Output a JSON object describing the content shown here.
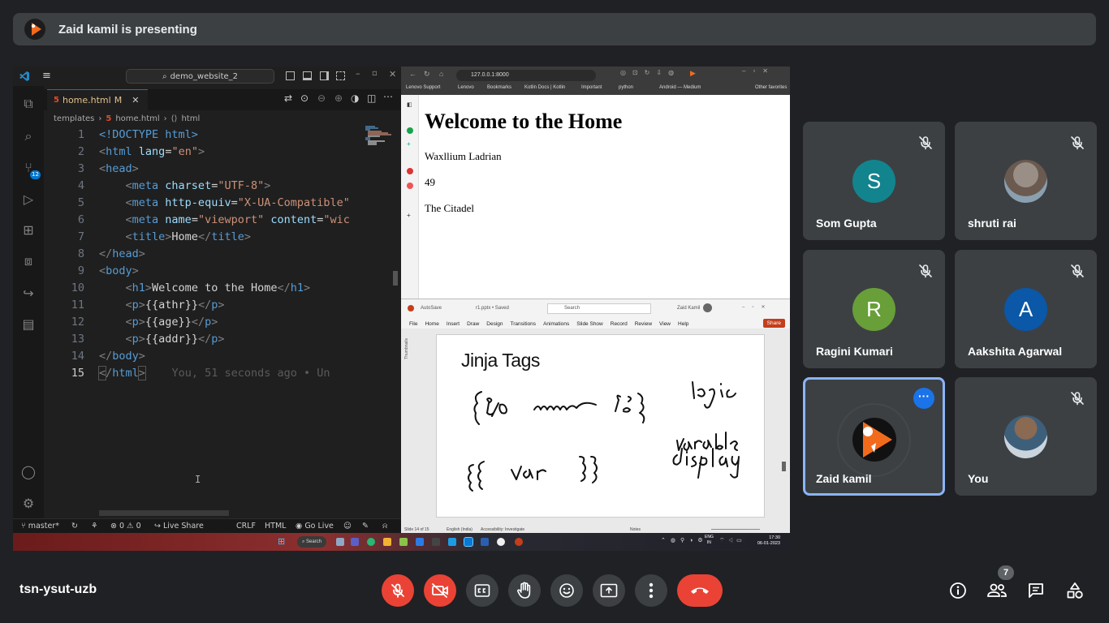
{
  "banner": {
    "text": "Zaid kamil is presenting"
  },
  "vscode": {
    "search": "demo_website_2",
    "tab": {
      "label": "home.html",
      "modified": "M"
    },
    "breadcrumbs": [
      "templates",
      "home.html",
      "html"
    ],
    "scm_badge": "12",
    "lines": [
      {
        "n": "1"
      },
      {
        "n": "2"
      },
      {
        "n": "3"
      },
      {
        "n": "4"
      },
      {
        "n": "5"
      },
      {
        "n": "6"
      },
      {
        "n": "7"
      },
      {
        "n": "8"
      },
      {
        "n": "9"
      },
      {
        "n": "10"
      },
      {
        "n": "11"
      },
      {
        "n": "12"
      },
      {
        "n": "13"
      },
      {
        "n": "14"
      },
      {
        "n": "15"
      }
    ],
    "code": {
      "l1": "<!DOCTYPE html>",
      "l2_tag": "html",
      "l2_attr": "lang",
      "l2_val": "\"en\"",
      "l3_tag": "head",
      "l4_tag": "meta",
      "l4_attr": "charset",
      "l4_val": "\"UTF-8\"",
      "l5_tag": "meta",
      "l5_attr": "http-equiv",
      "l5_val": "\"X-UA-Compatible\"",
      "l6_tag": "meta",
      "l6_attr1": "name",
      "l6_val1": "\"viewport\"",
      "l6_attr2": "content",
      "l6_val2": "\"wic",
      "l7_tag": "title",
      "l7_text": "Home",
      "l8_tag": "head",
      "l9_tag": "body",
      "l10_tag": "h1",
      "l10_text": "Welcome to the Home",
      "l11_tag": "p",
      "l11_text": "{{athr}}",
      "l12_tag": "p",
      "l12_text": "{{age}}",
      "l13_tag": "p",
      "l13_text": "{{addr}}",
      "l14_tag": "body",
      "l15_tag": "html",
      "l15_ghost": "You, 51 seconds ago • Un"
    },
    "status": {
      "branch": "master*",
      "problems": "⊗ 0 ⚠ 0",
      "live_share": "Live Share",
      "eol": "CRLF",
      "language": "HTML",
      "go_live": "Go Live"
    }
  },
  "browser": {
    "url": "127.0.0.1:8000",
    "bookmarks": [
      "Lenovo Support",
      "Lenovo",
      "Bookmarks",
      "Kotlin Docs | Kotlin",
      "Important",
      "python",
      "Android — Medium",
      "Other favorites"
    ],
    "heading": "Welcome to the Home",
    "p1": "Waxllium Ladrian",
    "p2": "49",
    "p3": "The Citadel"
  },
  "ppt": {
    "autosave": "AutoSave",
    "filename": "r1.pptx • Saved",
    "search": "Search",
    "user": "Zaid Kamil",
    "menu": [
      "File",
      "Home",
      "Insert",
      "Draw",
      "Design",
      "Transitions",
      "Animations",
      "Slide Show",
      "Record",
      "Review",
      "View",
      "Help"
    ],
    "share": "Share",
    "thumbnails": "Thumbnails",
    "slide_title": "Jinja Tags",
    "status_left": "Slide 14 of 15",
    "status_lang": "English (India)",
    "status_acc": "Accessibility: Investigate",
    "status_notes": "Notes"
  },
  "taskbar": {
    "search": "Search",
    "lang1": "ENG",
    "lang2": "IN",
    "time": "17:30",
    "date": "06-01-2023"
  },
  "participants": [
    {
      "name": "Som Gupta",
      "initial": "S",
      "color": "#12848e"
    },
    {
      "name": "shruti rai"
    },
    {
      "name": "Ragini Kumari",
      "initial": "R",
      "color": "#689f38"
    },
    {
      "name": "Aakshita Agarwal",
      "initial": "A",
      "color": "#0b57a8"
    },
    {
      "name": "Zaid kamil"
    },
    {
      "name": "You"
    }
  ],
  "bottom": {
    "meeting_code": "tsn-ysut-uzb",
    "people_count": "7"
  },
  "colors": {
    "accent_blue": "#8ab4f8",
    "danger_red": "#ea4335",
    "tile_bg": "#3c4043",
    "page_bg": "#202124"
  },
  "icons": [
    "mic-off-icon",
    "camera-off-icon",
    "captions-icon",
    "raise-hand-icon",
    "emoji-icon",
    "present-icon",
    "more-vert-icon",
    "end-call-icon",
    "info-icon",
    "people-icon",
    "chat-icon",
    "activities-icon"
  ]
}
